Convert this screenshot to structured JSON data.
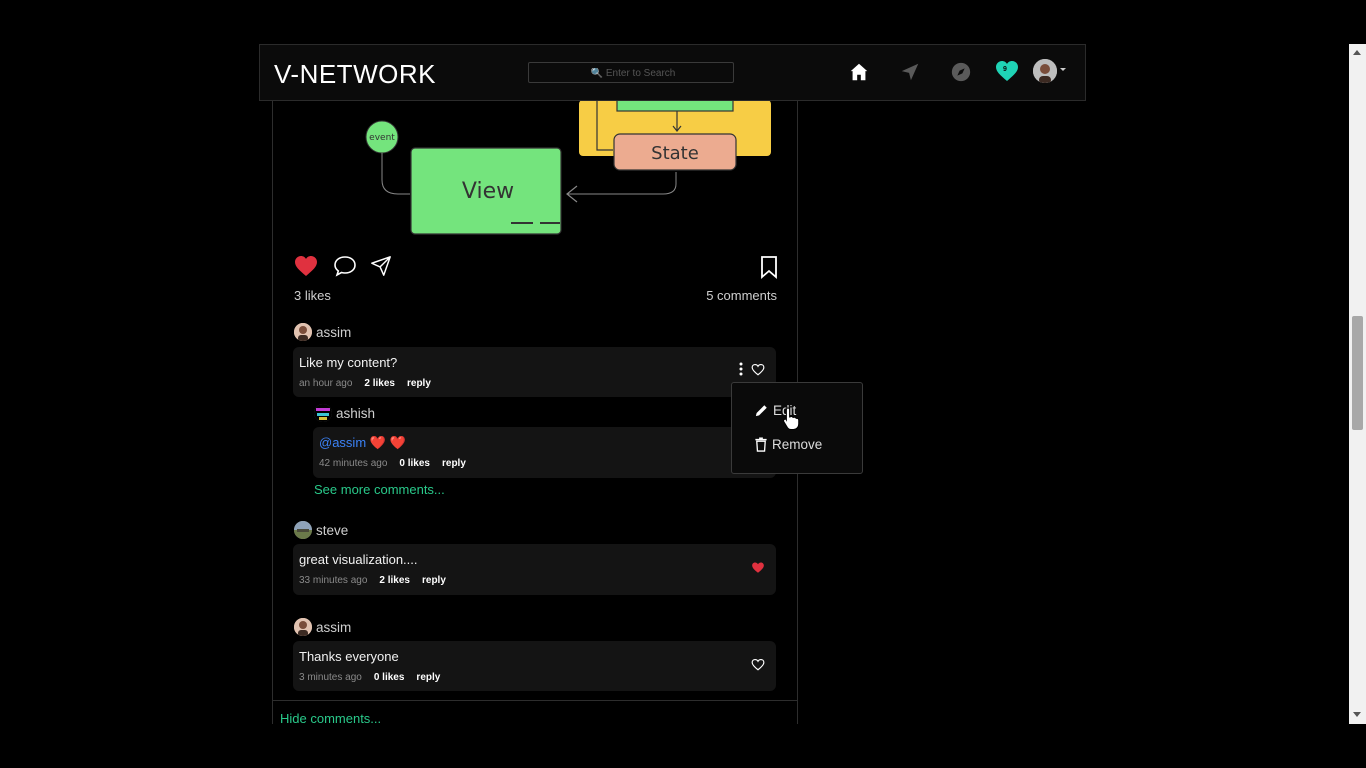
{
  "navbar": {
    "brand": "V-NETWORK",
    "search_placeholder": "🔍 Enter to Search",
    "notification_count": "9",
    "icons": [
      "home-icon",
      "send-icon",
      "explore-icon",
      "notification-heart-icon",
      "avatar-icon"
    ]
  },
  "diagram": {
    "event_label": "event",
    "view_label": "View",
    "state_label": "State"
  },
  "post": {
    "likes": "3 likes",
    "comments": "5 comments",
    "comments_list": [
      {
        "user": "assim",
        "text": "Like my content?",
        "time": "an hour ago",
        "likes": "2 likes",
        "reply": "reply"
      },
      {
        "user": "ashish",
        "mention": "@assim",
        "text": " ❤️ ❤️",
        "time": "42 minutes ago",
        "likes": "0 likes",
        "reply": "reply"
      },
      {
        "user": "steve",
        "text": "great visualization....",
        "time": "33 minutes ago",
        "likes": "2 likes",
        "reply": "reply"
      },
      {
        "user": "assim",
        "text": "Thanks everyone",
        "time": "3 minutes ago",
        "likes": "0 likes",
        "reply": "reply"
      }
    ],
    "see_more": "See more comments...",
    "hide_comments": "Hide comments..."
  },
  "dropdown": {
    "edit": "Edit",
    "remove": "Remove"
  },
  "colors": {
    "accent_green": "#29c98a",
    "heart_red": "#e0313f",
    "notif_teal": "#1fd3b5"
  }
}
